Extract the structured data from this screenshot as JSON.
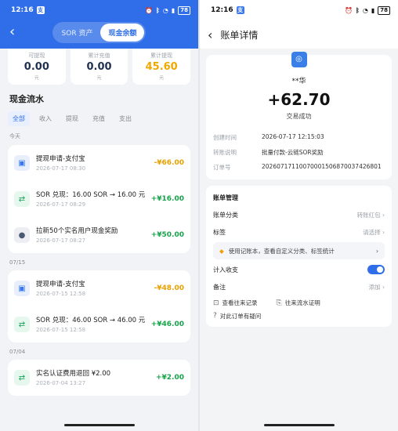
{
  "left": {
    "status": {
      "time": "12:16",
      "battery": "78"
    },
    "tabs": [
      "SOR 资产",
      "现金余额"
    ],
    "stats": [
      {
        "label": "可提现",
        "value": "0.00",
        "unit": "元"
      },
      {
        "label": "累计充值",
        "value": "0.00",
        "unit": "元"
      },
      {
        "label": "累计提现",
        "value": "45.60",
        "unit": "元"
      }
    ],
    "section_title": "现金流水",
    "filters": [
      "全部",
      "收入",
      "提现",
      "充值",
      "支出"
    ],
    "groups": [
      {
        "date": "今天",
        "items": [
          {
            "title": "提现申请-支付宝",
            "date": "2026-07-17 08:30",
            "amount": "-¥66.00",
            "icon": "wallet-icon"
          },
          {
            "title": "SOR 兑现：16.00 SOR → 16.00 元",
            "date": "2026-07-17 08:29",
            "amount": "+¥16.00",
            "icon": "exchange-icon"
          },
          {
            "title": "拉新50个实名用户现金奖励",
            "date": "2026-07-17 08:27",
            "amount": "+¥50.00",
            "icon": "user-icon"
          }
        ]
      },
      {
        "date": "07/15",
        "items": [
          {
            "title": "提现申请-支付宝",
            "date": "2026-07-15 12:58",
            "amount": "-¥48.00",
            "icon": "wallet-icon"
          },
          {
            "title": "SOR 兑现：46.00 SOR → 46.00 元",
            "date": "2026-07-15 12:58",
            "amount": "+¥46.00",
            "icon": "exchange-icon"
          }
        ]
      },
      {
        "date": "07/04",
        "items": [
          {
            "title": "实名认证费用退回 ¥2.00",
            "date": "2026-07-04 13:27",
            "amount": "+¥2.00",
            "icon": "exchange-icon"
          }
        ]
      }
    ]
  },
  "right": {
    "status": {
      "time": "12:16",
      "battery": "78"
    },
    "title": "账单详情",
    "name": "**华",
    "amount": "+62.70",
    "status_text": "交易成功",
    "details": [
      {
        "k": "创建时间",
        "v": "2026-07-17 12:15:03"
      },
      {
        "k": "转账说明",
        "v": "批量付款-云链SOR奖励"
      },
      {
        "k": "订单号",
        "v": "20260717110070001506870037426801"
      }
    ],
    "manage_title": "账单管理",
    "category_label": "账单分类",
    "category_value": "转账红包",
    "tag_label": "标签",
    "tag_value": "请选择",
    "banner": "使用记账本，查看自定义分类、标签统计",
    "income_label": "计入收支",
    "note_label": "备注",
    "note_value": "添加",
    "link1": "查看往来记录",
    "link2": "往来流水证明",
    "link3": "对此订单有疑问"
  }
}
